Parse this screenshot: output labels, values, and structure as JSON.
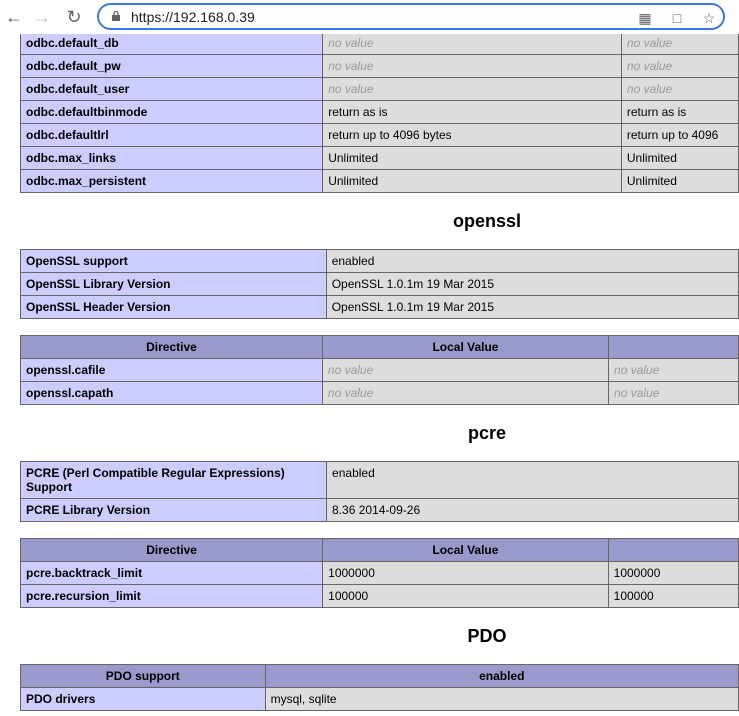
{
  "browser": {
    "url": "https://192.168.0.39"
  },
  "odbc_rows": [
    {
      "directive": "odbc.default_db",
      "local": "no value",
      "master": "no value",
      "nv": true
    },
    {
      "directive": "odbc.default_pw",
      "local": "no value",
      "master": "no value",
      "nv": true
    },
    {
      "directive": "odbc.default_user",
      "local": "no value",
      "master": "no value",
      "nv": true
    },
    {
      "directive": "odbc.defaultbinmode",
      "local": "return as is",
      "master": "return as is",
      "nv": false
    },
    {
      "directive": "odbc.defaultlrl",
      "local": "return up to 4096 bytes",
      "master": "return up to 4096",
      "nv": false
    },
    {
      "directive": "odbc.max_links",
      "local": "Unlimited",
      "master": "Unlimited",
      "nv": false
    },
    {
      "directive": "odbc.max_persistent",
      "local": "Unlimited",
      "master": "Unlimited",
      "nv": false
    }
  ],
  "openssl": {
    "title": "openssl",
    "info": [
      {
        "label": "OpenSSL support",
        "value": "enabled"
      },
      {
        "label": "OpenSSL Library Version",
        "value": "OpenSSL 1.0.1m 19 Mar 2015"
      },
      {
        "label": "OpenSSL Header Version",
        "value": "OpenSSL 1.0.1m 19 Mar 2015"
      }
    ],
    "header": {
      "directive": "Directive",
      "local": "Local Value"
    },
    "rows": [
      {
        "directive": "openssl.cafile",
        "local": "no value",
        "master": "no value"
      },
      {
        "directive": "openssl.capath",
        "local": "no value",
        "master": "no value"
      }
    ]
  },
  "pcre": {
    "title": "pcre",
    "info": [
      {
        "label": "PCRE (Perl Compatible Regular Expressions) Support",
        "value": "enabled"
      },
      {
        "label": "PCRE Library Version",
        "value": "8.36 2014-09-26"
      }
    ],
    "header": {
      "directive": "Directive",
      "local": "Local Value"
    },
    "rows": [
      {
        "directive": "pcre.backtrack_limit",
        "local": "1000000",
        "master": "1000000"
      },
      {
        "directive": "pcre.recursion_limit",
        "local": "100000",
        "master": "100000"
      }
    ]
  },
  "pdo": {
    "title": "PDO",
    "header": {
      "label": "PDO support",
      "value": "enabled"
    },
    "rows": [
      {
        "label": "PDO drivers",
        "value": "mysql, sqlite"
      }
    ]
  }
}
